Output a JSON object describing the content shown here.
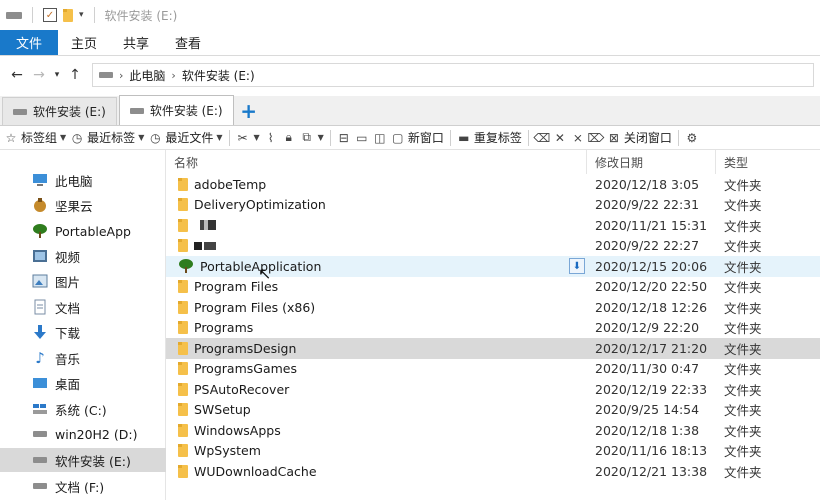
{
  "window": {
    "title": "软件安装 (E:)"
  },
  "ribbon": {
    "tabs": [
      "文件",
      "主页",
      "共享",
      "查看"
    ]
  },
  "address": {
    "crumbs": [
      "此电脑",
      "软件安装 (E:)"
    ]
  },
  "doc_tabs": [
    {
      "label": "软件安装 (E:)",
      "active": false
    },
    {
      "label": "软件安装 (E:)",
      "active": true
    }
  ],
  "toolbar": {
    "bookmark_group": "标签组",
    "recent_bookmark": "最近标签",
    "recent_file": "最近文件",
    "new_window": "新窗口",
    "reopen_tab": "重复标签",
    "close_window": "关闭窗口"
  },
  "sidebar": {
    "items": [
      {
        "label": "此电脑",
        "icon": "computer-icon"
      },
      {
        "label": "坚果云",
        "icon": "nutstore-icon"
      },
      {
        "label": "PortableApp",
        "icon": "tree-icon"
      },
      {
        "label": "视频",
        "icon": "video-icon"
      },
      {
        "label": "图片",
        "icon": "pictures-icon"
      },
      {
        "label": "文档",
        "icon": "documents-icon"
      },
      {
        "label": "下载",
        "icon": "download-icon"
      },
      {
        "label": "音乐",
        "icon": "music-icon"
      },
      {
        "label": "桌面",
        "icon": "desktop-icon"
      },
      {
        "label": "系统 (C:)",
        "icon": "windows-drive-icon"
      },
      {
        "label": "win20H2 (D:)",
        "icon": "drive-icon"
      },
      {
        "label": "软件安装 (E:)",
        "icon": "drive-icon",
        "selected": true
      },
      {
        "label": "文档 (F:)",
        "icon": "drive-icon"
      }
    ]
  },
  "columns": {
    "name": "名称",
    "date": "修改日期",
    "type": "类型"
  },
  "files": [
    {
      "name": "adobeTemp",
      "date": "2020/12/18 3:05",
      "type": "文件夹"
    },
    {
      "name": "DeliveryOptimization",
      "date": "2020/9/22 22:31",
      "type": "文件夹"
    },
    {
      "name": "",
      "date": "2020/11/21 15:31",
      "type": "文件夹"
    },
    {
      "name": "",
      "date": "2020/9/22 22:27",
      "type": "文件夹"
    },
    {
      "name": "PortableApplication",
      "date": "2020/12/15 20:06",
      "type": "文件夹",
      "hover": true
    },
    {
      "name": "Program Files",
      "date": "2020/12/20 22:50",
      "type": "文件夹"
    },
    {
      "name": "Program Files (x86)",
      "date": "2020/12/18 12:26",
      "type": "文件夹"
    },
    {
      "name": "Programs",
      "date": "2020/12/9 22:20",
      "type": "文件夹"
    },
    {
      "name": "ProgramsDesign",
      "date": "2020/12/17 21:20",
      "type": "文件夹",
      "selected": true
    },
    {
      "name": "ProgramsGames",
      "date": "2020/11/30 0:47",
      "type": "文件夹"
    },
    {
      "name": "PSAutoRecover",
      "date": "2020/12/19 22:33",
      "type": "文件夹"
    },
    {
      "name": "SWSetup",
      "date": "2020/9/25 14:54",
      "type": "文件夹"
    },
    {
      "name": "WindowsApps",
      "date": "2020/12/18 1:38",
      "type": "文件夹"
    },
    {
      "name": "WpSystem",
      "date": "2020/11/16 18:13",
      "type": "文件夹"
    },
    {
      "name": "WUDownloadCache",
      "date": "2020/12/21 13:38",
      "type": "文件夹"
    }
  ],
  "colors": {
    "accent": "#1979ca",
    "selected": "#d9d9d9",
    "hover": "#e5f3fb",
    "folder": "#f5c04a"
  }
}
